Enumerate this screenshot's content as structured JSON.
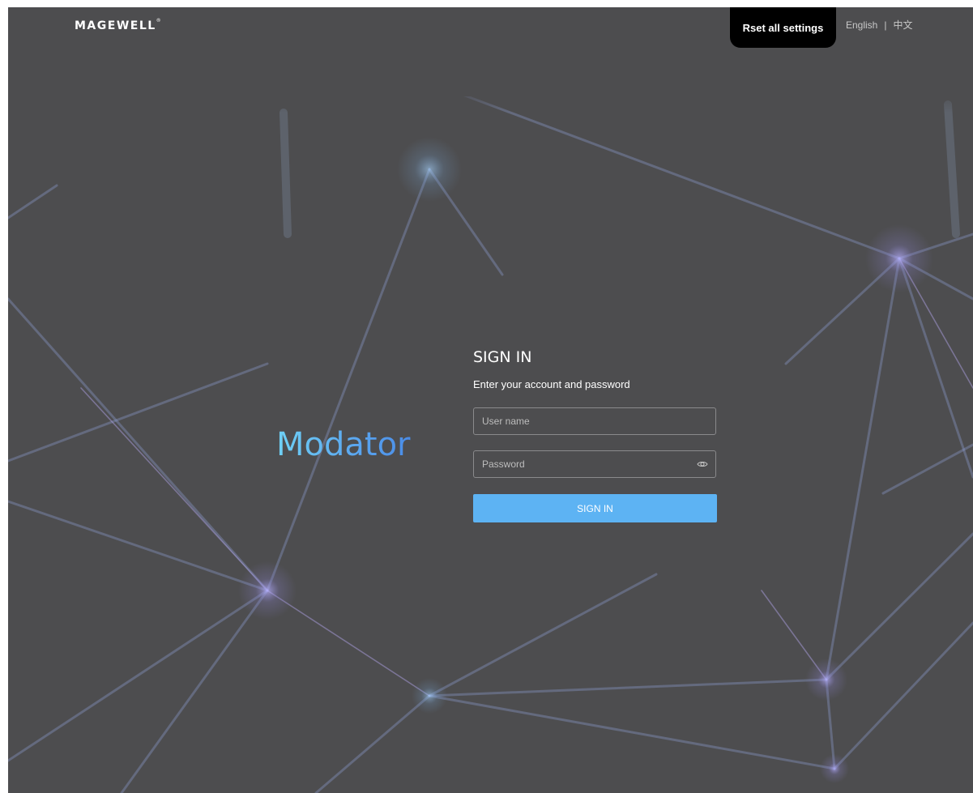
{
  "header": {
    "logo_text": "MAGEWELL",
    "logo_mark": "®",
    "reset_label": "Rset all settings",
    "lang_english": "English",
    "lang_separator": "|",
    "lang_chinese": "中文"
  },
  "brand": {
    "name": "Modator"
  },
  "signin": {
    "title": "SIGN IN",
    "subtitle": "Enter your account and password",
    "username_placeholder": "User name",
    "username_value": "",
    "password_placeholder": "Password",
    "password_value": "",
    "submit_label": "SIGN IN",
    "submit_color": "#5db3f3"
  },
  "icons": {
    "password_toggle": "eye-icon"
  }
}
